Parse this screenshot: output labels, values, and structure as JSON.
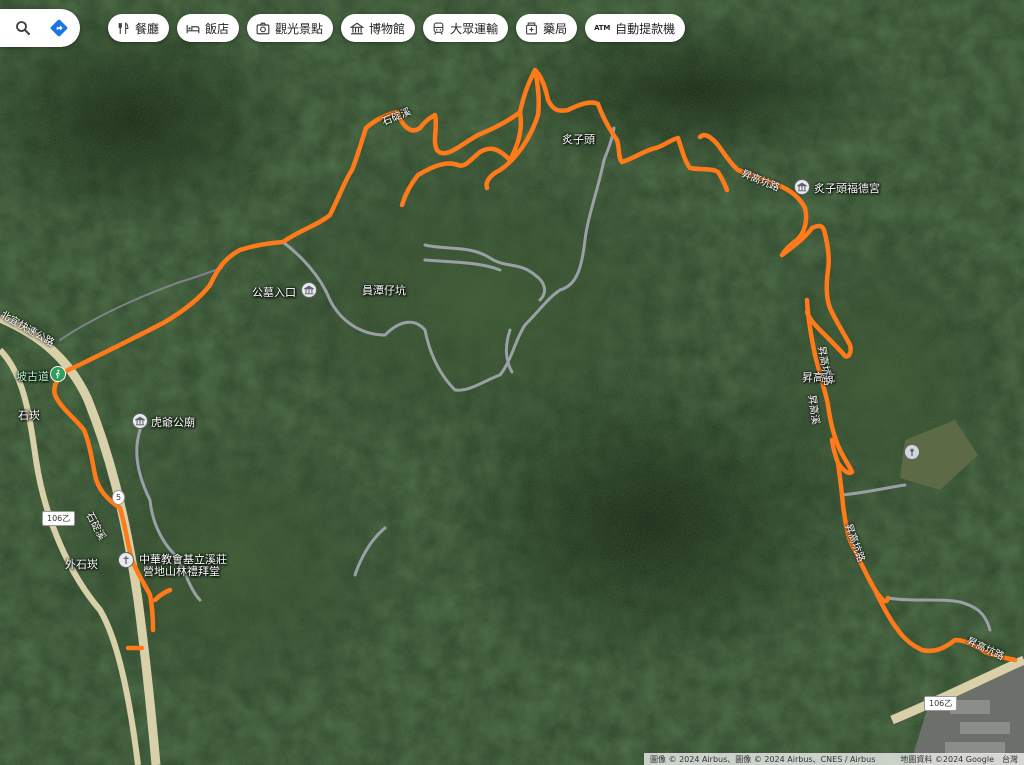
{
  "search": {
    "icon": "search-icon",
    "directions_icon": "directions-icon"
  },
  "chips": [
    {
      "label": "餐廳",
      "icon": "restaurant-icon"
    },
    {
      "label": "飯店",
      "icon": "hotel-icon"
    },
    {
      "label": "觀光景點",
      "icon": "camera-icon"
    },
    {
      "label": "博物館",
      "icon": "museum-icon"
    },
    {
      "label": "大眾運輸",
      "icon": "transit-icon"
    },
    {
      "label": "藥局",
      "icon": "pharmacy-icon"
    },
    {
      "label": "自動提款機",
      "icon": "atm-icon",
      "glyph": "ATM"
    }
  ],
  "places": {
    "zhi_zi_tou": "炙子頭",
    "fude_temple": "炙子頭福德宮",
    "cemetery": "公墓入口",
    "yuantan": "員潭仔坑",
    "banqiao": "坡古道",
    "shitan": "石崁",
    "hu_temple": "虎爺公廟",
    "church_line1": "中華教會基立溪莊",
    "church_line2": "營地山林禮拜堂",
    "outer_shitan": "外石崁",
    "shenggao": "昇高坑"
  },
  "roads": {
    "shidingxi": "石碇溪",
    "shidingxi_lower": "石碇溪",
    "shenggao_rd_top": "昇高坑路",
    "shenggao_rd_mid": "昇高坑路",
    "shenggao_rd_bottom": "昇高坑路",
    "shenggao_stream": "昇高溪",
    "highway_left": "北宜快速公路",
    "r106b_left": "106乙",
    "r106b_right": "106乙",
    "r5": "5"
  },
  "footer": {
    "copyright": "圖像 © 2024 Airbus、圖像 © 2024 Airbus、CNES / Airbus",
    "map_data": "地圖資料 ©2024 Google",
    "region": "台灣"
  },
  "colors": {
    "trail": "#ff7a1a",
    "road_gray": "#9aa0a6",
    "highway": "#d8d0a8",
    "forest_dark": "#1b2d1b",
    "forest_mid": "#2b4226"
  }
}
